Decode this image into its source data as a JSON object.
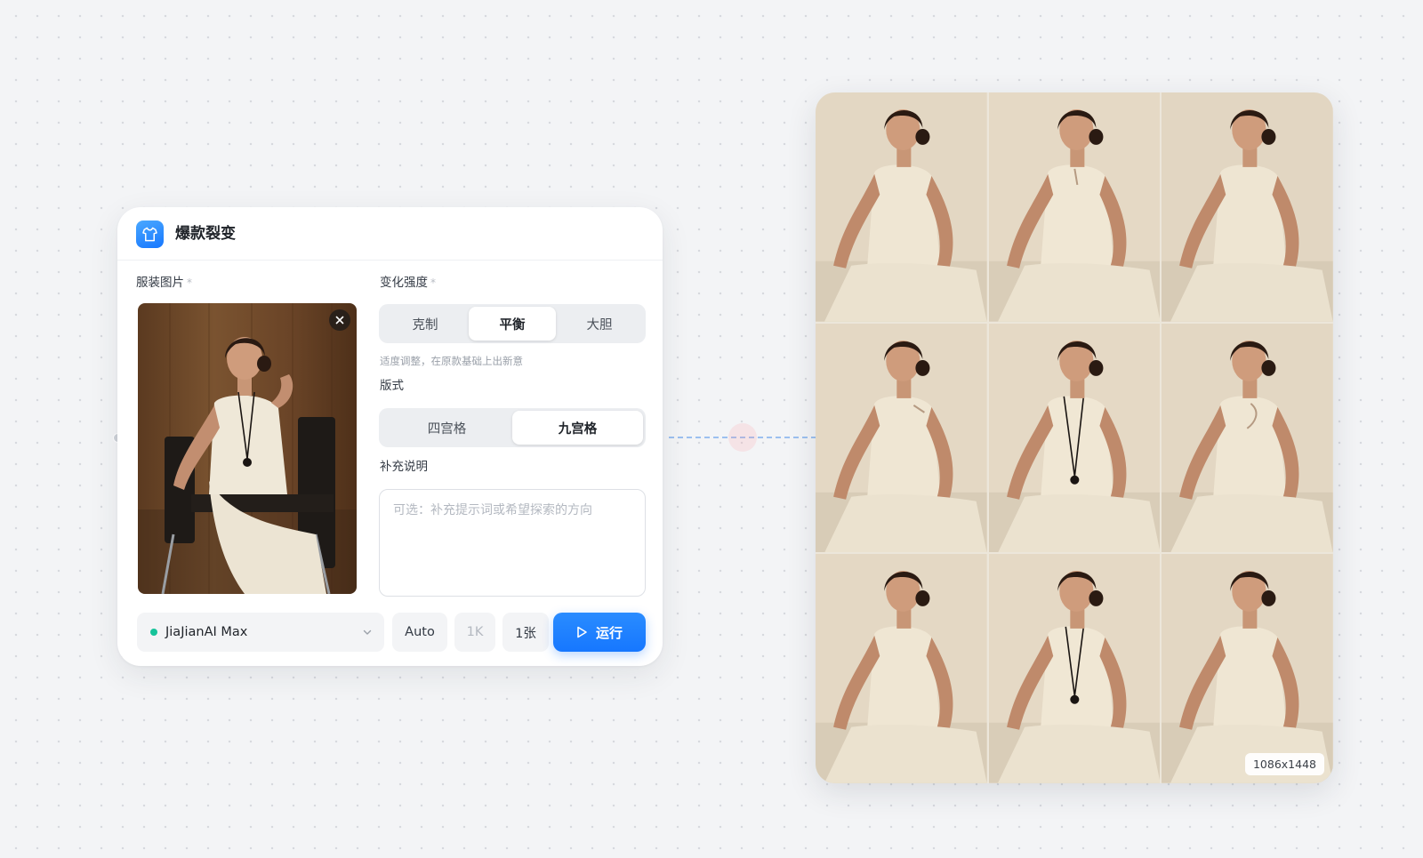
{
  "node": {
    "title": "爆款裂变",
    "icon": "shirt-icon"
  },
  "garment": {
    "label": "服装图片",
    "required": "*"
  },
  "intensity": {
    "label": "变化强度",
    "required": "*",
    "options": [
      "克制",
      "平衡",
      "大胆"
    ],
    "selected": "平衡",
    "hint": "适度调整，在原款基础上出新意"
  },
  "layout": {
    "label": "版式",
    "options": [
      "四宫格",
      "九宫格"
    ],
    "selected": "九宫格"
  },
  "note": {
    "label": "补充说明",
    "placeholder": "可选：补充提示词或希望探索的方向",
    "value": ""
  },
  "toolbar": {
    "model": "JiaJianAI Max",
    "model_status_color": "#16c39a",
    "ratio": "Auto",
    "resolution": "1K",
    "count": "1张",
    "run_label": "运行"
  },
  "result": {
    "size_label": "1086x1448",
    "tiles": 9
  },
  "colors": {
    "accent": "#1677ff",
    "card_bg": "#ffffff",
    "canvas_bg": "#f3f4f6",
    "result_backdrop": "#ece6da"
  }
}
